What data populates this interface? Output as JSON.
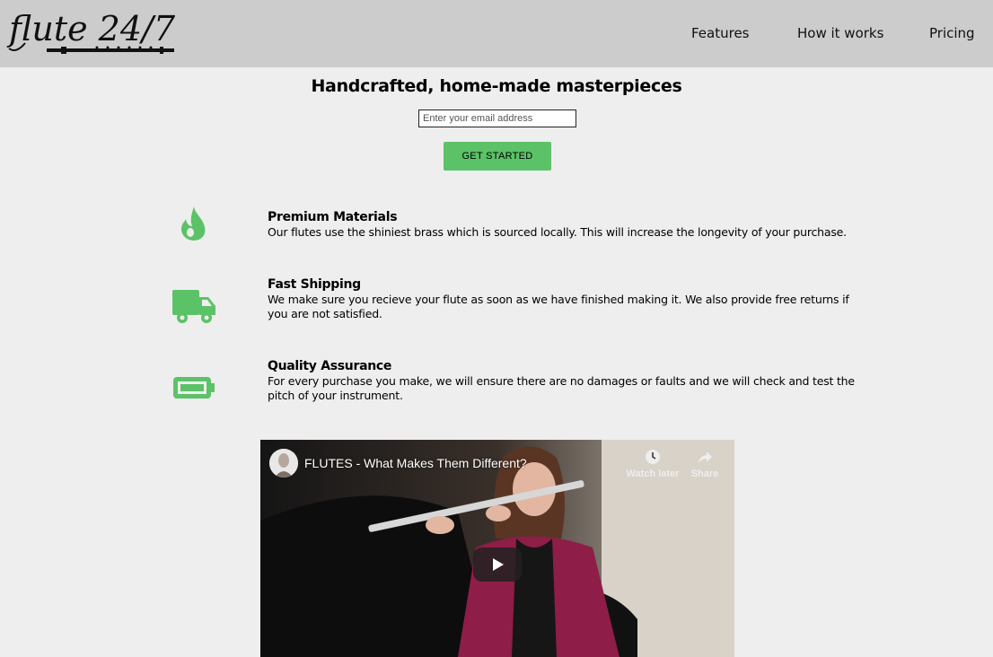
{
  "header": {
    "logo_text": "flute 24/7",
    "nav": [
      "Features",
      "How it works",
      "Pricing"
    ]
  },
  "hero": {
    "title": "Handcrafted, home-made masterpieces",
    "email_placeholder": "Enter your email address",
    "cta_label": "GET STARTED"
  },
  "features": [
    {
      "icon": "flame-icon",
      "title": "Premium Materials",
      "description": "Our flutes use the shiniest brass which is sourced locally. This will increase the longevity of your purchase."
    },
    {
      "icon": "truck-icon",
      "title": "Fast Shipping",
      "description": "We make sure you recieve your flute as soon as we have finished making it. We also provide free returns if you are not satisfied."
    },
    {
      "icon": "battery-icon",
      "title": "Quality Assurance",
      "description": "For every purchase you make, we will ensure there are no damages or faults and we will check and test the pitch of your instrument."
    }
  ],
  "video": {
    "title": "FLUTES - What Makes Them Different?",
    "watch_later_label": "Watch later",
    "share_label": "Share"
  },
  "colors": {
    "header_bg": "#cccccc",
    "page_bg": "#eeeeee",
    "accent_green": "#5cc267"
  }
}
